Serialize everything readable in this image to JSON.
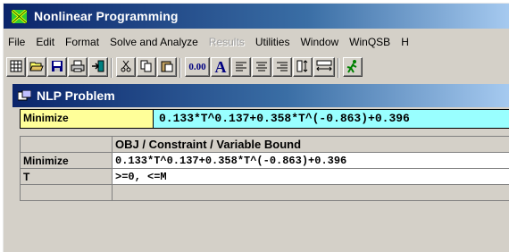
{
  "window": {
    "title": "Nonlinear Programming"
  },
  "menu": [
    "File",
    "Edit",
    "Format",
    "Solve and Analyze",
    "Results",
    "Utilities",
    "Window",
    "WinQSB",
    "H"
  ],
  "menu_disabled": [
    "Results"
  ],
  "toolbar": {
    "zero_decimal_label": "0.00",
    "font_label": "A"
  },
  "problem_window": {
    "title": "NLP Problem",
    "objective_label": "Minimize",
    "objective_expression": "0.133*T^0.137+0.358*T^(-0.863)+0.396",
    "table": {
      "column_header": "OBJ / Constraint / Variable Bound",
      "rows": [
        {
          "label": "Minimize",
          "value": "0.133*T^0.137+0.358*T^(-0.863)+0.396"
        },
        {
          "label": "T",
          "value": ">=0, <=M"
        }
      ]
    }
  },
  "colors": {
    "title_gradient_start": "#0a246a",
    "objective_label_bg": "#ffff99",
    "objective_expr_bg": "#99ffff",
    "face": "#d4d0c8"
  }
}
